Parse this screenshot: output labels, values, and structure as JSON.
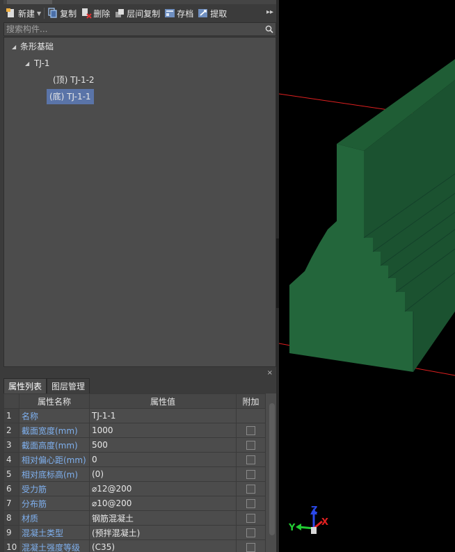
{
  "toolbar": {
    "new_label": "新建",
    "copy_label": "复制",
    "delete_label": "删除",
    "floor_copy_label": "层间复制",
    "save_label": "存档",
    "extract_label": "提取",
    "more_glyph": "▸▸"
  },
  "search": {
    "placeholder": "搜索构件..."
  },
  "tree": {
    "root": "条形基础",
    "child": "TJ-1",
    "leaves": [
      "(顶) TJ-1-2",
      "(底) TJ-1-1"
    ]
  },
  "bottom": {
    "close_glyph": "×",
    "tabs": [
      "属性列表",
      "图层管理"
    ]
  },
  "properties": {
    "headers": [
      "属性名称",
      "属性值",
      "附加"
    ],
    "rows": [
      {
        "idx": "1",
        "name": "名称",
        "value": "TJ-1-1",
        "check": false
      },
      {
        "idx": "2",
        "name": "截面宽度(mm)",
        "value": "1000",
        "check": true
      },
      {
        "idx": "3",
        "name": "截面高度(mm)",
        "value": "500",
        "check": true
      },
      {
        "idx": "4",
        "name": "相对偏心距(mm)",
        "value": "0",
        "check": true
      },
      {
        "idx": "5",
        "name": "相对底标高(m)",
        "value": "(0)",
        "check": true
      },
      {
        "idx": "6",
        "name": "受力筋",
        "value": "⌀12@200",
        "check": true
      },
      {
        "idx": "7",
        "name": "分布筋",
        "value": "⌀10@200",
        "check": true
      },
      {
        "idx": "8",
        "name": "材质",
        "value": "钢筋混凝土",
        "check": true
      },
      {
        "idx": "9",
        "name": "混凝土类型",
        "value": "(预拌混凝土)",
        "check": true
      },
      {
        "idx": "10",
        "name": "混凝土强度等级",
        "value": "(C35)",
        "check": true
      }
    ]
  },
  "axes": {
    "x": "X",
    "y": "Y",
    "z": "Z"
  },
  "colors": {
    "accent_selection": "#5a74a8",
    "property_name": "#7fb0ee",
    "model_front": "#23663b",
    "model_side": "#1c5530",
    "axis_red": "#e02020",
    "axis_green": "#22cc33",
    "axis_blue": "#2a48e8"
  }
}
